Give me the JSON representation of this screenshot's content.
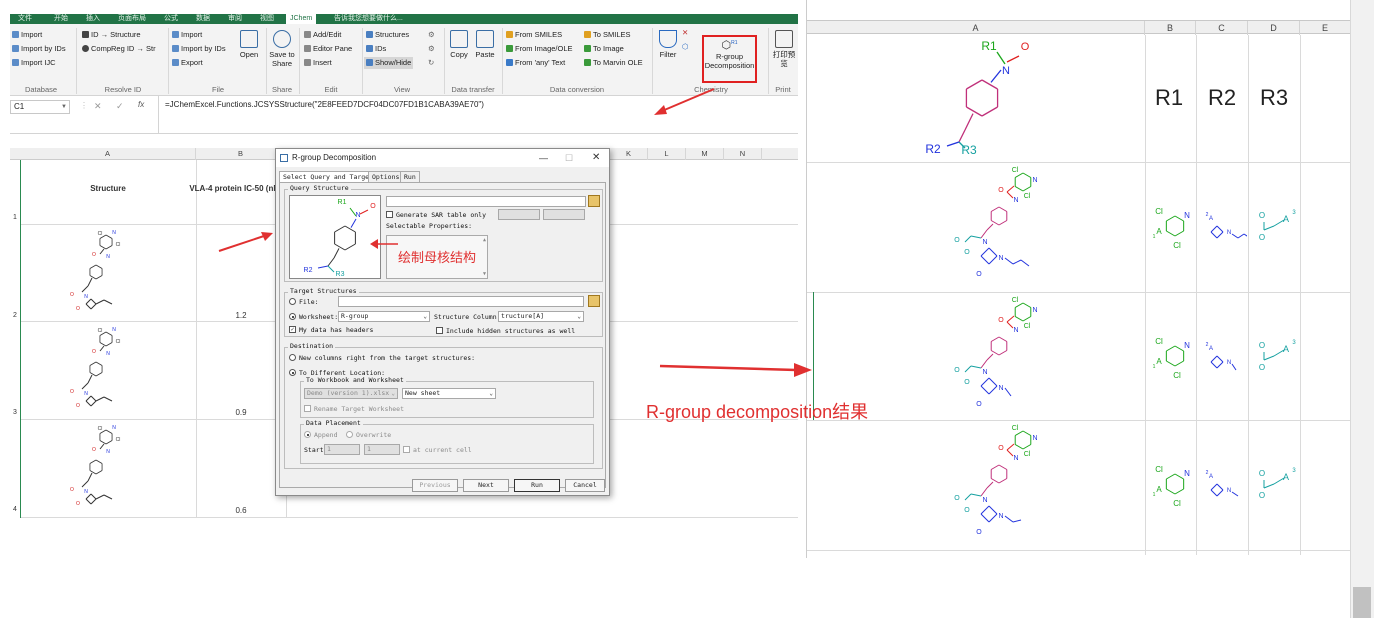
{
  "ribbon": {
    "tabs": [
      "文件",
      "开始",
      "插入",
      "页面布局",
      "公式",
      "数据",
      "审阅",
      "视图",
      "JChem",
      "告诉我您想要做什么..."
    ],
    "active_tab": "JChem",
    "database": {
      "import": "Import",
      "import_by_ids": "Import by IDs",
      "import_ijc": "Import IJC",
      "group": "Database"
    },
    "resolve_id": {
      "id_structure": "ID → Structure",
      "compreg": "CompReg ID → Str",
      "group": "Resolve ID"
    },
    "file": {
      "import": "Import",
      "import_by_ids": "Import by IDs",
      "export": "Export",
      "open": "Open",
      "group": "File"
    },
    "share": {
      "save_to_share": "Save to Share",
      "group": "Share"
    },
    "edit": {
      "add_edit": "Add/Edit",
      "editor_pane": "Editor Pane",
      "insert": "Insert",
      "group": "Edit"
    },
    "view": {
      "structures": "Structures",
      "ids": "IDs",
      "show_hide": "Show/Hide",
      "group": "View"
    },
    "transfer": {
      "copy": "Copy",
      "paste": "Paste",
      "group": "Data transfer"
    },
    "conversion": {
      "from_smiles": "From SMILES",
      "from_image": "From Image/OLE",
      "from_any": "From 'any' Text",
      "to_smiles": "To SMILES",
      "to_image": "To Image",
      "to_marvin": "To Marvin OLE",
      "group": "Data conversion"
    },
    "chemistry": {
      "filter": "Filter",
      "rgroup": "R-group Decomposition",
      "group": "Chemistry"
    },
    "print": {
      "preview": "打印预览",
      "group": "Print"
    }
  },
  "formula_bar": {
    "name_box": "C1",
    "formula": "=JChemExcel.Functions.JCSYSStructure(\"2E8FEED7DCF04DC07FD1B1CABA39AE70\")"
  },
  "left_sheet": {
    "columns": [
      "A",
      "B",
      "C",
      "D",
      "E",
      "F",
      "G",
      "H",
      "I",
      "J",
      "K",
      "L",
      "M",
      "N"
    ],
    "header_structure": "Structure",
    "header_ic50": "VLA-4 protein IC-50 (nM)",
    "rows": [
      {
        "num": "1",
        "ic50": ""
      },
      {
        "num": "2",
        "ic50": "1.2"
      },
      {
        "num": "3",
        "ic50": "0.9"
      },
      {
        "num": "4",
        "ic50": "0.6"
      }
    ]
  },
  "dialog": {
    "title": "R-group Decomposition",
    "tabs": [
      "Select Query and Target",
      "Options",
      "Run"
    ],
    "query_legend": "Query Structure",
    "generate_sar": "Generate SAR table only",
    "selectable_props": "Selectable Properties:",
    "target_legend": "Target Structures",
    "file_label": "File:",
    "worksheet_label": "Worksheet:",
    "worksheet_value": "R-group",
    "structure_column_label": "Structure Column:",
    "structure_column_value": "tructure[A]",
    "has_headers": "My data has headers",
    "include_hidden": "Include hidden structures as well",
    "dest_legend": "Destination",
    "new_columns": "New columns right from the target structures:",
    "different_location": "To Different Location:",
    "wb_ws_legend": "To Workbook and Worksheet",
    "workbook_value": "Demo (version 1).xlsx",
    "sheet_value": "New sheet",
    "rename_ws": "Rename Target Worksheet",
    "placement_legend": "Data Placement",
    "append": "Append",
    "overwrite": "Overwrite",
    "start": "Start",
    "start_row": "1",
    "start_col": "1",
    "at_current": "at current cell",
    "btn_previous": "Previous",
    "btn_next": "Next",
    "btn_run": "Run",
    "btn_cancel": "Cancel"
  },
  "annotations": {
    "draw_core": "绘制母核结构",
    "result": "R-group decomposition结果"
  },
  "right_sheet": {
    "columns": [
      "A",
      "B",
      "C",
      "D",
      "E"
    ],
    "row_labels": [
      "R1",
      "R2",
      "R3"
    ],
    "colors": {
      "r1": "#1aa61a",
      "r2": "#2233dd",
      "r3": "#14a0a0"
    }
  },
  "chem_labels": {
    "R1": "R1",
    "R2": "R2",
    "R3": "R3",
    "N": "N",
    "O": "O",
    "Cl": "Cl",
    "A": "A",
    "A1": "1",
    "A2": "2",
    "A3": "3"
  }
}
